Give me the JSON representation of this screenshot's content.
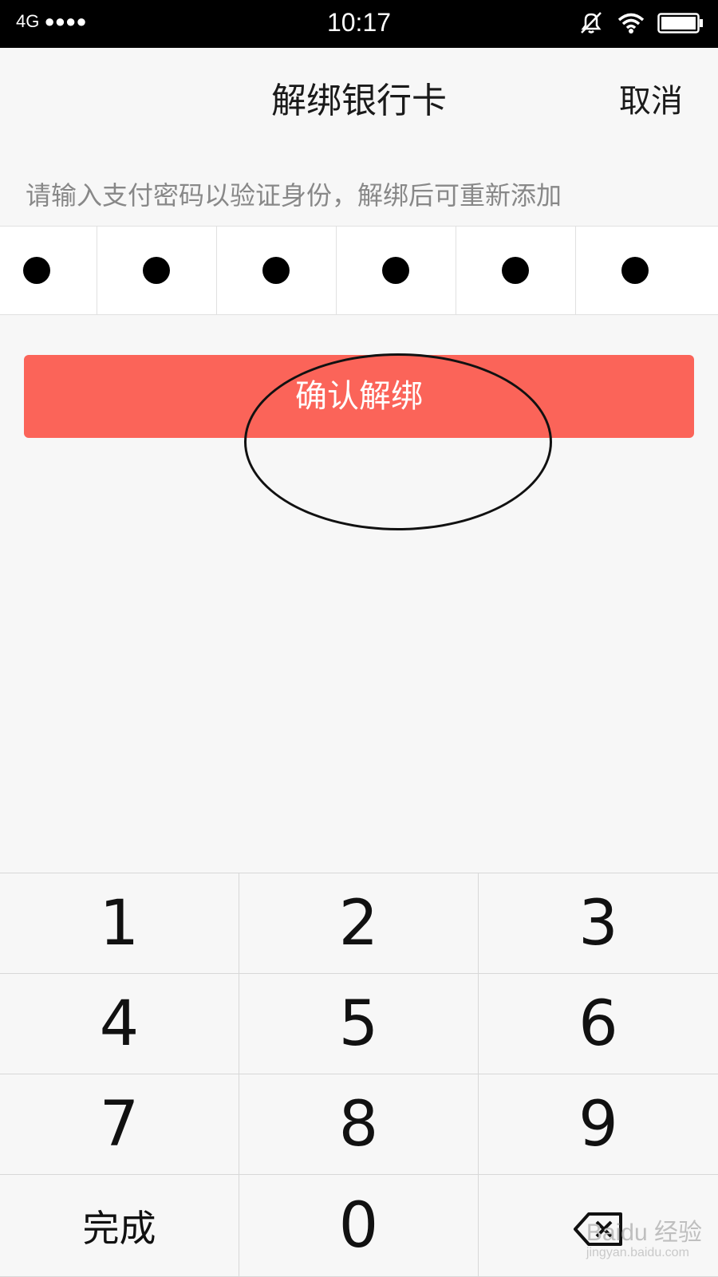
{
  "status_bar": {
    "network": "4G ●●●●",
    "time": "10:17",
    "icons": [
      "alarm-off-icon",
      "wifi-icon",
      "battery-icon"
    ]
  },
  "nav": {
    "title": "解绑银行卡",
    "cancel_label": "取消"
  },
  "hint": "请输入支付密码以验证身份，解绑后可重新添加",
  "password": {
    "length": 6,
    "filled": 6
  },
  "confirm_button": {
    "label": "确认解绑",
    "color": "#fb6459"
  },
  "keypad": {
    "keys": [
      "1",
      "2",
      "3",
      "4",
      "5",
      "6",
      "7",
      "8",
      "9",
      "完成",
      "0",
      "⌫"
    ]
  },
  "watermark": {
    "text": "Baidu 经验",
    "url_text": "jingyan.baidu.com"
  }
}
